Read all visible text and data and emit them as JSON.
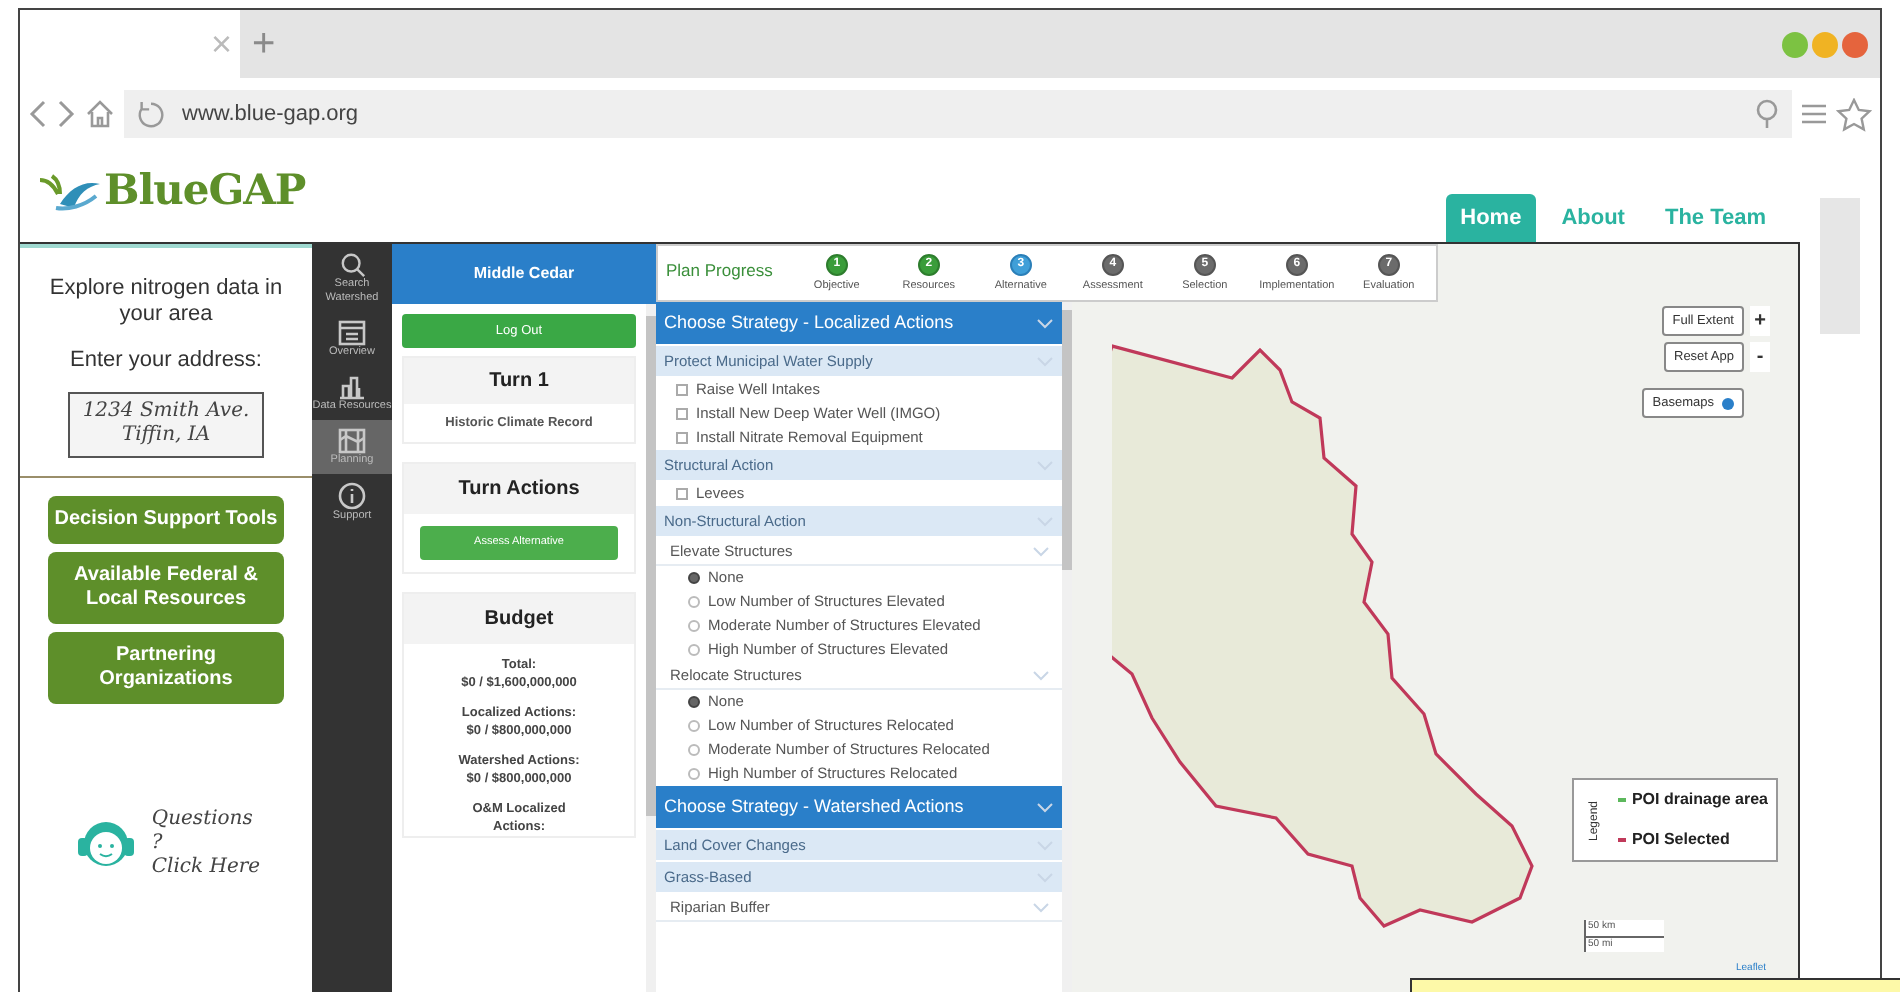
{
  "browser": {
    "tab_close": "×",
    "new_tab": "+",
    "url": "www.blue-gap.org"
  },
  "header": {
    "logo": "BlueGAP",
    "nav": [
      {
        "label": "Home",
        "selected": true
      },
      {
        "label": "About",
        "selected": false
      },
      {
        "label": "The Team",
        "selected": false
      }
    ]
  },
  "sidebar": {
    "title": "Explore nitrogen data in your area",
    "address_label": "Enter your address:",
    "address_value": "1234 Smith Ave. Tiffin, IA",
    "buttons": [
      "Decision Support Tools",
      "Available Federal & Local Resources",
      "Partnering Organizations"
    ],
    "help": [
      "Questions",
      "?",
      "Click Here"
    ]
  },
  "icon_bar": [
    {
      "label": "Search Watershed",
      "selected": false
    },
    {
      "label": "Overview",
      "selected": false
    },
    {
      "label": "Data Resources",
      "selected": false
    },
    {
      "label": "Planning",
      "selected": true
    },
    {
      "label": "Support",
      "selected": false
    }
  ],
  "panel": {
    "title": "Middle Cedar",
    "logout": "Log Out",
    "turn": "Turn 1",
    "climate": "Historic Climate Record",
    "actions_title": "Turn Actions",
    "assess": "Assess Alternative",
    "budget_title": "Budget",
    "budget": [
      {
        "label": "Total:",
        "value": "$0 / $1,600,000,000"
      },
      {
        "label": "Localized Actions:",
        "value": "$0 / $800,000,000"
      },
      {
        "label": "Watershed Actions:",
        "value": "$0 / $800,000,000"
      },
      {
        "label": "O&M Localized Actions:"
      }
    ]
  },
  "progress": {
    "title": "Plan Progress",
    "steps": [
      {
        "number": "1",
        "label": "Objective",
        "completed": true,
        "current": false
      },
      {
        "number": "2",
        "label": "Resources",
        "completed": true,
        "current": false
      },
      {
        "number": "3",
        "label": "Alternative",
        "completed": false,
        "current": true
      },
      {
        "number": "4",
        "label": "Assessment",
        "completed": false,
        "current": false
      },
      {
        "number": "5",
        "label": "Selection",
        "completed": false,
        "current": false
      },
      {
        "number": "6",
        "label": "Implementation",
        "completed": false,
        "current": false
      },
      {
        "number": "7",
        "label": "Evaluation",
        "completed": false,
        "current": false
      }
    ]
  },
  "strategy": [
    {
      "title": "Choose Strategy - Localized Actions",
      "groups": [
        {
          "title": "Protect Municipal Water Supply",
          "items": [
            {
              "kind": "checkbox",
              "label": "Raise Well Intakes",
              "checked": false
            },
            {
              "kind": "checkbox",
              "label": "Install New Deep Water Well (IMGO)",
              "checked": false
            },
            {
              "kind": "checkbox",
              "label": "Install Nitrate Removal Equipment",
              "checked": false
            }
          ]
        },
        {
          "title": "Structural Action",
          "items": [
            {
              "kind": "checkbox",
              "label": "Levees",
              "checked": false
            }
          ]
        },
        {
          "title": "Non-Structural Action",
          "items": [
            {
              "kind": "subgroup",
              "label": "Elevate Structures"
            },
            {
              "kind": "radio",
              "label": "None",
              "selected": true
            },
            {
              "kind": "radio",
              "label": "Low Number of Structures Elevated",
              "selected": false
            },
            {
              "kind": "radio",
              "label": "Moderate Number of Structures Elevated",
              "selected": false
            },
            {
              "kind": "radio",
              "label": "High Number of Structures Elevated",
              "selected": false
            },
            {
              "kind": "subgroup",
              "label": "Relocate Structures"
            },
            {
              "kind": "radio",
              "label": "None",
              "selected": true
            },
            {
              "kind": "radio",
              "label": "Low Number of Structures Relocated",
              "selected": false
            },
            {
              "kind": "radio",
              "label": "Moderate Number of Structures Relocated",
              "selected": false
            },
            {
              "kind": "radio",
              "label": "High Number of Structures Relocated",
              "selected": false
            }
          ]
        }
      ]
    },
    {
      "title": "Choose Strategy - Watershed Actions",
      "groups": [
        {
          "title": "Land Cover Changes"
        },
        {
          "title": "Grass-Based",
          "items": [
            {
              "kind": "subgroup",
              "label": "Riparian Buffer"
            }
          ]
        }
      ]
    }
  ],
  "map": {
    "buttons": [
      "Full Extent",
      "Reset App"
    ],
    "zoom": [
      "+",
      "-"
    ],
    "basemaps": "Basemaps",
    "legend": {
      "title": "Legend",
      "items": [
        {
          "label": "POI drainage area",
          "color": "#5cb85c"
        },
        {
          "label": "POI Selected",
          "color": "#c0395a"
        }
      ]
    },
    "scale": [
      "50 km",
      "50 mi"
    ],
    "attribution": "Leaflet"
  }
}
